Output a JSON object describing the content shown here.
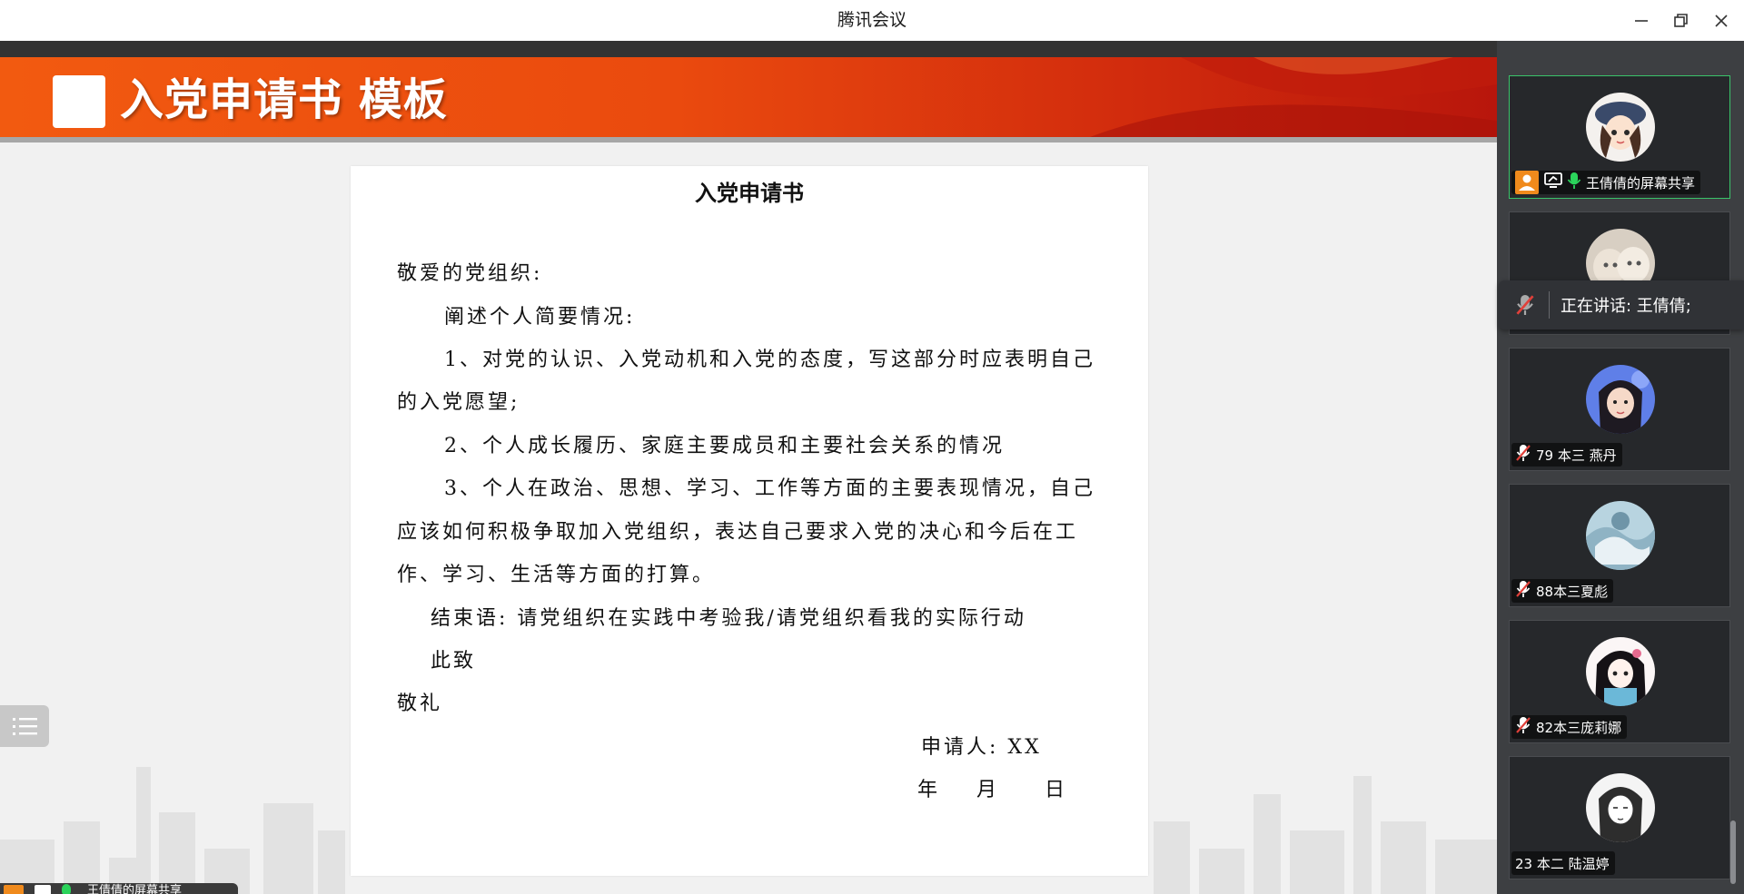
{
  "window": {
    "title": "腾讯会议"
  },
  "slide": {
    "banner_title": "入党申请书  模板",
    "doc_title": "入党申请书",
    "lines": [
      "敬爱的党组织:",
      "阐述个人简要情况:",
      "1、对党的认识、入党动机和入党的态度，写这部分时应表明自己",
      "的入党愿望;",
      "2、个人成长履历、家庭主要成员和主要社会关系的情况",
      "3、个人在政治、思想、学习、工作等方面的主要表现情况，自己",
      "应该如何积极争取加入党组织，表达自己要求入党的决心和今后在工",
      "作、学习、生活等方面的打算。",
      "结束语: 请党组织在实践中考验我/请党组织看我的实际行动",
      "此致",
      "敬礼",
      "申请人: XX",
      "年    月     日"
    ]
  },
  "presenter_badge": {
    "text": "王倩倩的屏幕共享"
  },
  "speaking": {
    "text": "正在讲话: 王倩倩;"
  },
  "participants": [
    {
      "name": "王倩倩的屏幕共享",
      "muted": false,
      "sharing": true,
      "active": true
    },
    {
      "name": "",
      "muted": true,
      "sharing": false,
      "active": false
    },
    {
      "name": "79 本三 燕丹",
      "muted": true,
      "sharing": false,
      "active": false
    },
    {
      "name": "88本三夏彪",
      "muted": true,
      "sharing": false,
      "active": false
    },
    {
      "name": "82本三庞莉娜",
      "muted": true,
      "sharing": false,
      "active": false
    },
    {
      "name": "23 本二 陆温婷",
      "muted": false,
      "sharing": false,
      "active": false
    }
  ],
  "colors": {
    "speaking_green": "#2bd45b",
    "muted_red": "#e0403a",
    "share_orange": "#f08a1c"
  }
}
